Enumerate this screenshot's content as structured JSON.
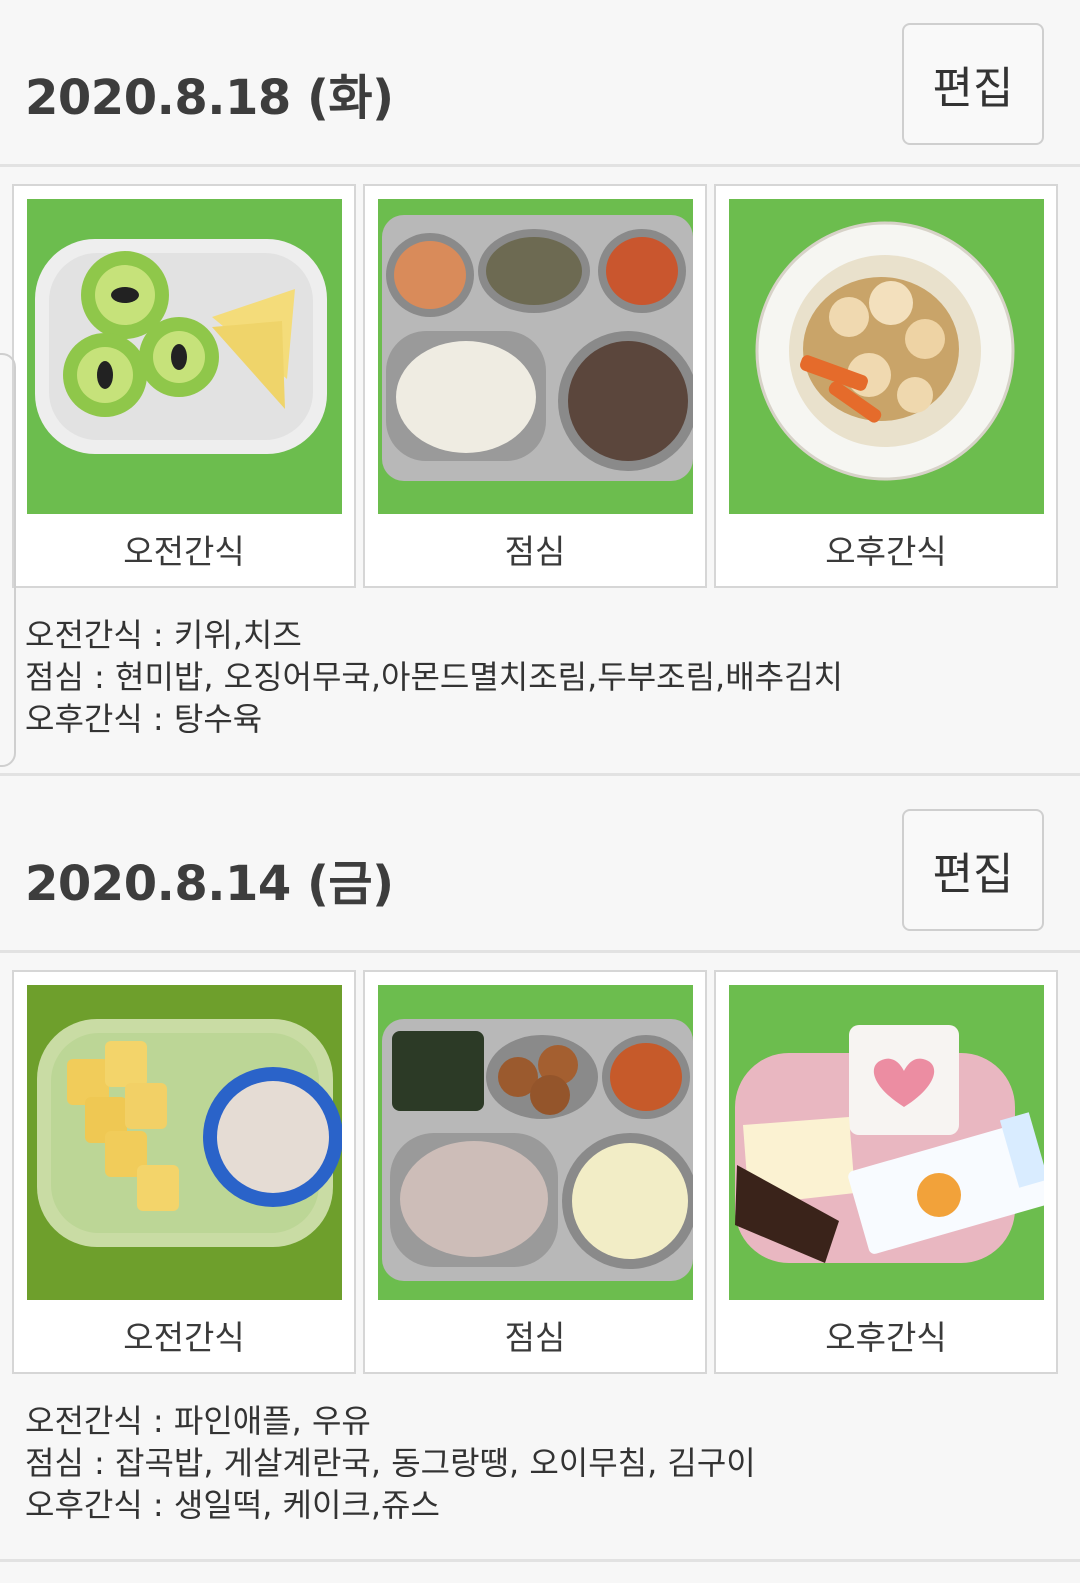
{
  "days": [
    {
      "date": "2020.8.18 (화)",
      "edit_label": "편집",
      "meals": [
        {
          "caption": "오전간식",
          "photo": "kiwi-cheese-photo"
        },
        {
          "caption": "점심",
          "photo": "lunch-tray-photo"
        },
        {
          "caption": "오후간식",
          "photo": "sweet-sour-pork-photo"
        }
      ],
      "menu_lines": [
        "오전간식 : 키위,치즈",
        "점심 : 현미밥, 오징어무국,아몬드멸치조림,두부조림,배추김치",
        "오후간식 : 탕수육"
      ]
    },
    {
      "date": "2020.8.14 (금)",
      "edit_label": "편집",
      "meals": [
        {
          "caption": "오전간식",
          "photo": "pineapple-milk-photo"
        },
        {
          "caption": "점심",
          "photo": "lunch-tray-photo"
        },
        {
          "caption": "오후간식",
          "photo": "rice-cake-cake-juice-photo"
        }
      ],
      "menu_lines": [
        "오전간식 : 파인애플, 우유",
        "점심 : 잡곡밥, 게살계란국, 동그랑땡, 오이무침, 김구이",
        "오후간식 : 생일떡, 케이크,쥬스"
      ]
    }
  ],
  "colors": {
    "background": "#f7f7f7",
    "card_border": "#d6d6d6",
    "photo_green": "#6fbf4f",
    "text": "#333333"
  }
}
